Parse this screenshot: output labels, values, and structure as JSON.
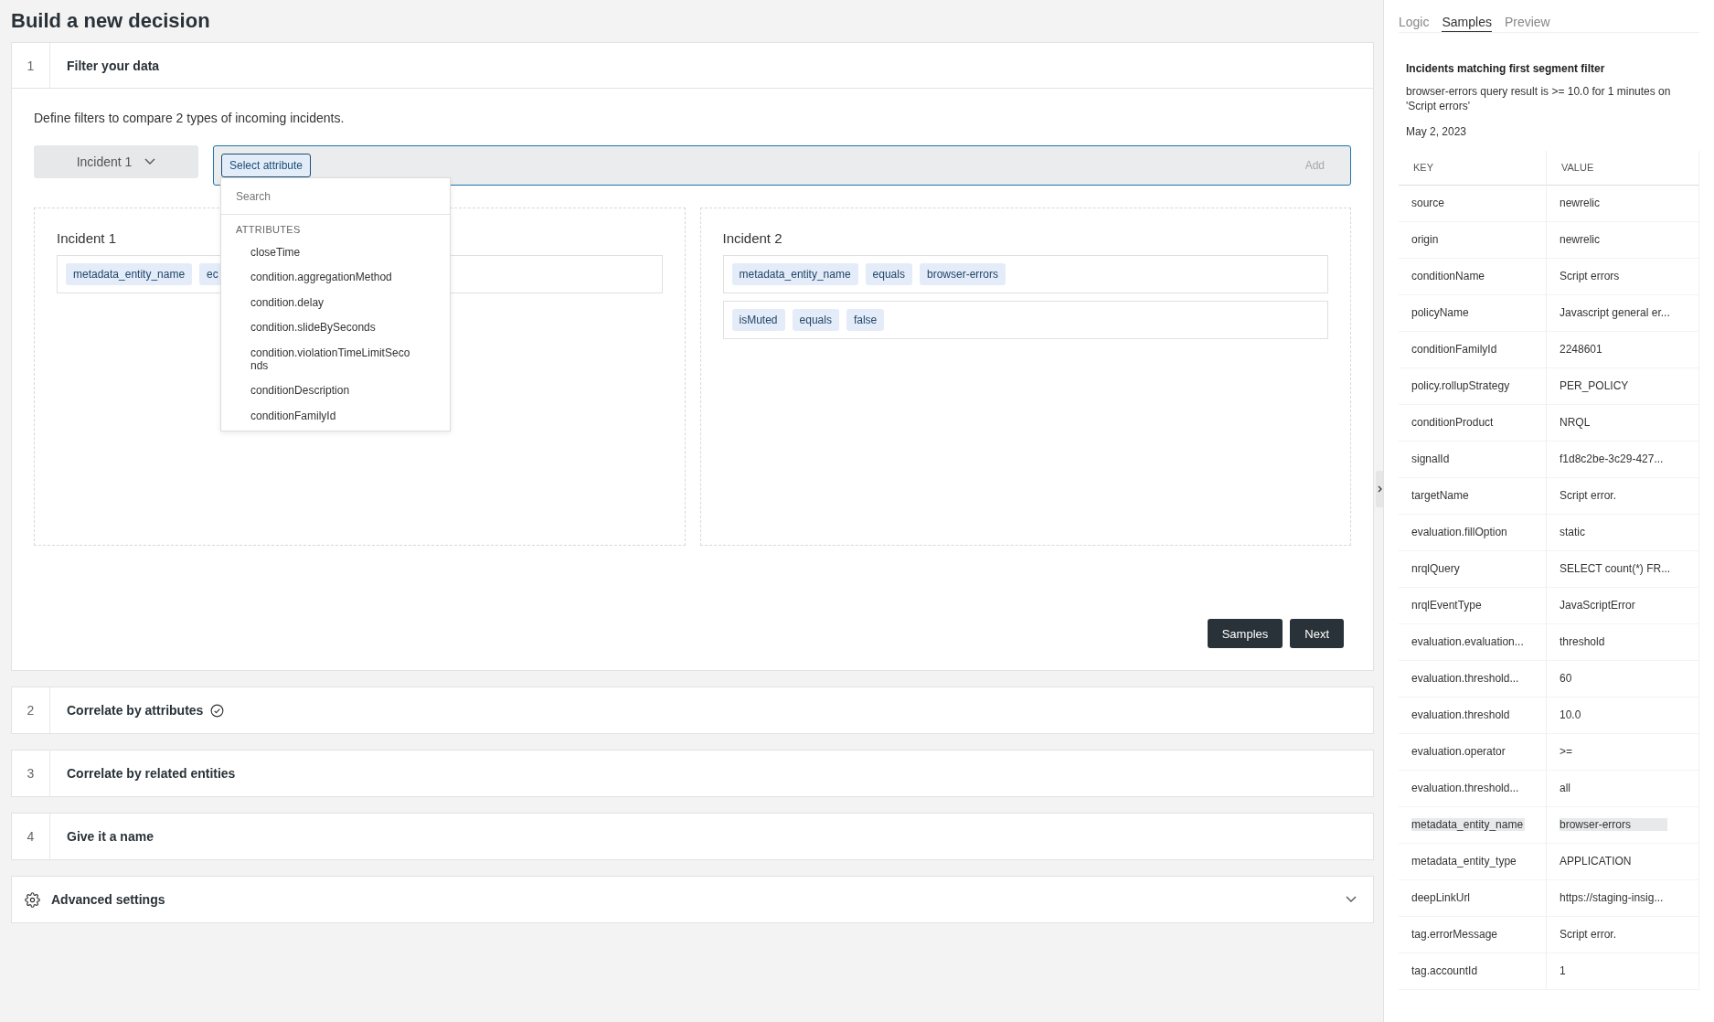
{
  "page_title": "Build a new decision",
  "steps": [
    {
      "number": "1",
      "title": "Filter your data",
      "expanded": true,
      "completed": false
    },
    {
      "number": "2",
      "title": "Correlate by attributes",
      "expanded": false,
      "completed": true
    },
    {
      "number": "3",
      "title": "Correlate by related entities",
      "expanded": false,
      "completed": false
    },
    {
      "number": "4",
      "title": "Give it a name",
      "expanded": false,
      "completed": false
    }
  ],
  "filter": {
    "description": "Define filters to compare 2 types of incoming incidents.",
    "incident_select": "Incident 1",
    "attribute_chip": "Select attribute",
    "add_button": "Add",
    "dropdown": {
      "search_placeholder": "Search",
      "section": "ATTRIBUTES",
      "items": [
        "closeTime",
        "condition.aggregationMethod",
        "condition.delay",
        "condition.slideBySeconds",
        "condition.violationTimeLimitSeconds",
        "conditionDescription",
        "conditionFamilyId"
      ]
    },
    "incidents": [
      {
        "title": "Incident 1",
        "conditions": [
          {
            "chips": [
              "metadata_entity_name",
              "ec"
            ]
          }
        ]
      },
      {
        "title": "Incident 2",
        "conditions": [
          {
            "chips": [
              "metadata_entity_name",
              "equals",
              "browser-errors"
            ]
          },
          {
            "chips": [
              "isMuted",
              "equals",
              "false"
            ]
          }
        ]
      }
    ],
    "buttons": [
      "Samples",
      "Next"
    ]
  },
  "advanced": {
    "title": "Advanced settings",
    "expanded": false
  },
  "side_panel": {
    "tabs": [
      {
        "label": "Logic",
        "selected": false
      },
      {
        "label": "Samples",
        "selected": true
      },
      {
        "label": "Preview",
        "selected": false
      }
    ],
    "heading": "Incidents matching first segment filter",
    "summary": "browser-errors query result is >= 10.0 for 1 minutes on 'Script errors'",
    "date": "May 2, 2023",
    "columns": [
      "KEY",
      "VALUE"
    ],
    "rows": [
      {
        "key": "source",
        "value": "newrelic",
        "highlighted": false
      },
      {
        "key": "origin",
        "value": "newrelic",
        "highlighted": false
      },
      {
        "key": "conditionName",
        "value": "Script errors",
        "highlighted": false
      },
      {
        "key": "policyName",
        "value": "Javascript general er...",
        "highlighted": false
      },
      {
        "key": "conditionFamilyId",
        "value": "2248601",
        "highlighted": false
      },
      {
        "key": "policy.rollupStrategy",
        "value": "PER_POLICY",
        "highlighted": false
      },
      {
        "key": "conditionProduct",
        "value": "NRQL",
        "highlighted": false
      },
      {
        "key": "signalId",
        "value": "f1d8c2be-3c29-427...",
        "highlighted": false
      },
      {
        "key": "targetName",
        "value": "Script error.",
        "highlighted": false
      },
      {
        "key": "evaluation.fillOption",
        "value": "static",
        "highlighted": false
      },
      {
        "key": "nrqlQuery",
        "value": "SELECT count(*) FR...",
        "highlighted": false
      },
      {
        "key": "nrqlEventType",
        "value": "JavaScriptError",
        "highlighted": false
      },
      {
        "key": "evaluation.evaluation...",
        "value": "threshold",
        "highlighted": false
      },
      {
        "key": "evaluation.threshold...",
        "value": "60",
        "highlighted": false
      },
      {
        "key": "evaluation.threshold",
        "value": "10.0",
        "highlighted": false
      },
      {
        "key": "evaluation.operator",
        "value": ">=",
        "highlighted": false
      },
      {
        "key": "evaluation.threshold...",
        "value": "all",
        "highlighted": false
      },
      {
        "key": "metadata_entity_name",
        "value": "browser-errors",
        "highlighted": true
      },
      {
        "key": "metadata_entity_type",
        "value": "APPLICATION",
        "highlighted": false
      },
      {
        "key": "deepLinkUrl",
        "value": "https://staging-insig...",
        "highlighted": false
      },
      {
        "key": "tag.errorMessage",
        "value": "Script error.",
        "highlighted": false
      },
      {
        "key": "tag.accountId",
        "value": "1",
        "highlighted": false
      }
    ]
  }
}
